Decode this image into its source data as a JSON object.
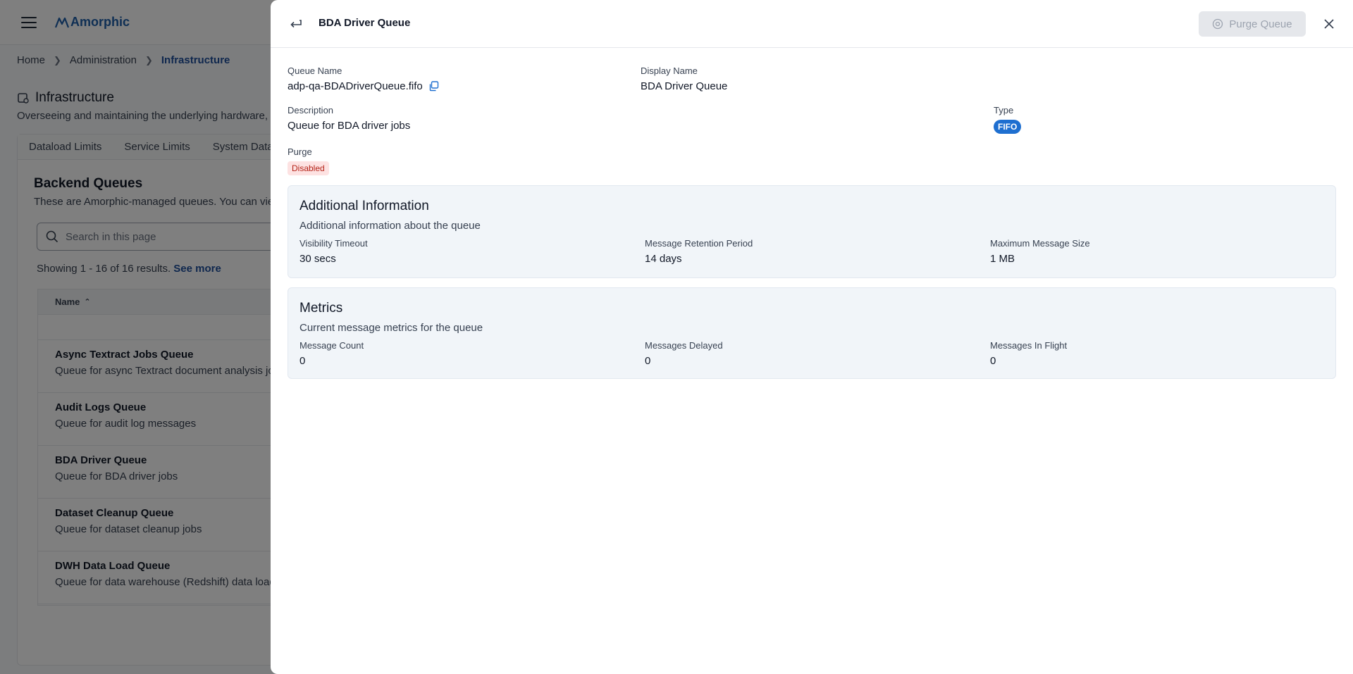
{
  "app": {
    "logo_text": "Amorphic",
    "breadcrumbs": [
      "Home",
      "Administration",
      "Infrastructure"
    ],
    "page_title": "Infrastructure",
    "page_subtitle": "Overseeing and maintaining the underlying hardware,",
    "tabs": [
      "Dataload Limits",
      "Service Limits",
      "System Datas"
    ],
    "section_title": "Backend Queues",
    "section_desc": "These are Amorphic-managed queues. You can view",
    "search_placeholder": "Search in this page",
    "results_text": "Showing 1 - 16 of 16 results.",
    "see_more": "See more",
    "table_header": "Name",
    "rows": [
      {
        "name": "Async Textract Jobs Queue",
        "desc": "Queue for async Textract document analysis jobs"
      },
      {
        "name": "Audit Logs Queue",
        "desc": "Queue for audit log messages"
      },
      {
        "name": "BDA Driver Queue",
        "desc": "Queue for BDA driver jobs"
      },
      {
        "name": "Dataset Cleanup Queue",
        "desc": "Queue for dataset cleanup jobs"
      },
      {
        "name": "DWH Data Load Queue",
        "desc": "Queue for data warehouse (Redshift) data load"
      }
    ]
  },
  "drawer": {
    "title": "BDA Driver Queue",
    "purge_button": "Purge Queue",
    "queue_name_label": "Queue Name",
    "queue_name_value": "adp-qa-BDADriverQueue.fifo",
    "display_name_label": "Display Name",
    "display_name_value": "BDA Driver Queue",
    "description_label": "Description",
    "description_value": "Queue for BDA driver jobs",
    "type_label": "Type",
    "type_value": "FIFO",
    "purge_label": "Purge",
    "purge_value": "Disabled",
    "additional": {
      "title": "Additional Information",
      "subtitle": "Additional information about the queue",
      "items": [
        {
          "label": "Visibility Timeout",
          "value": "30 secs"
        },
        {
          "label": "Message Retention Period",
          "value": "14 days"
        },
        {
          "label": "Maximum Message Size",
          "value": "1 MB"
        }
      ]
    },
    "metrics": {
      "title": "Metrics",
      "subtitle": "Current message metrics for the queue",
      "items": [
        {
          "label": "Message Count",
          "value": "0"
        },
        {
          "label": "Messages Delayed",
          "value": "0"
        },
        {
          "label": "Messages In Flight",
          "value": "0"
        }
      ]
    }
  },
  "colors": {
    "accent": "#1e4f9c",
    "fifo_badge": "#1e6fd0",
    "disabled_badge_bg": "#fde2e2",
    "disabled_badge_text": "#b42318",
    "card_bg": "#f1f5f9"
  }
}
